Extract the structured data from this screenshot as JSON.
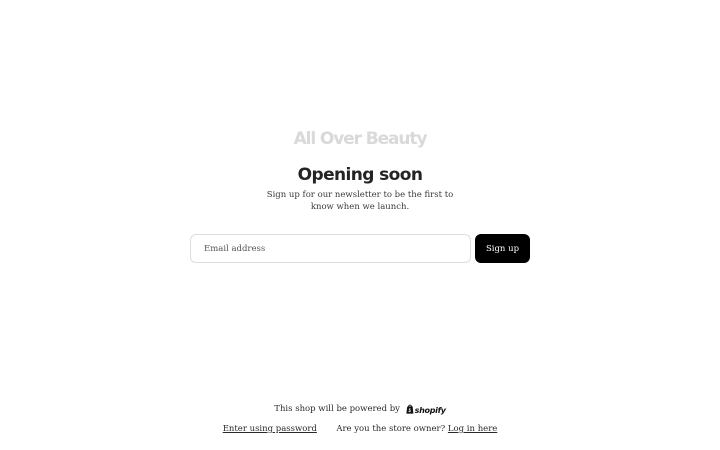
{
  "store": {
    "name": "All Over Beauty"
  },
  "main": {
    "heading": "Opening soon",
    "subtext": "Sign up for our newsletter to be the first to know when we launch."
  },
  "newsletter": {
    "email_placeholder": "Email address",
    "email_value": "",
    "signup_label": "Sign up"
  },
  "footer": {
    "powered_by_text": "This shop will be powered by",
    "shopify_word": "shopify",
    "enter_password_label": "Enter using password",
    "owner_question": "Are you the store owner?",
    "login_label": "Log in here"
  },
  "colors": {
    "button_bg": "#000000",
    "store_name": "#d9d9d9",
    "input_border": "#dedede"
  },
  "icons": {
    "shopify": "shopify-bag-icon"
  }
}
